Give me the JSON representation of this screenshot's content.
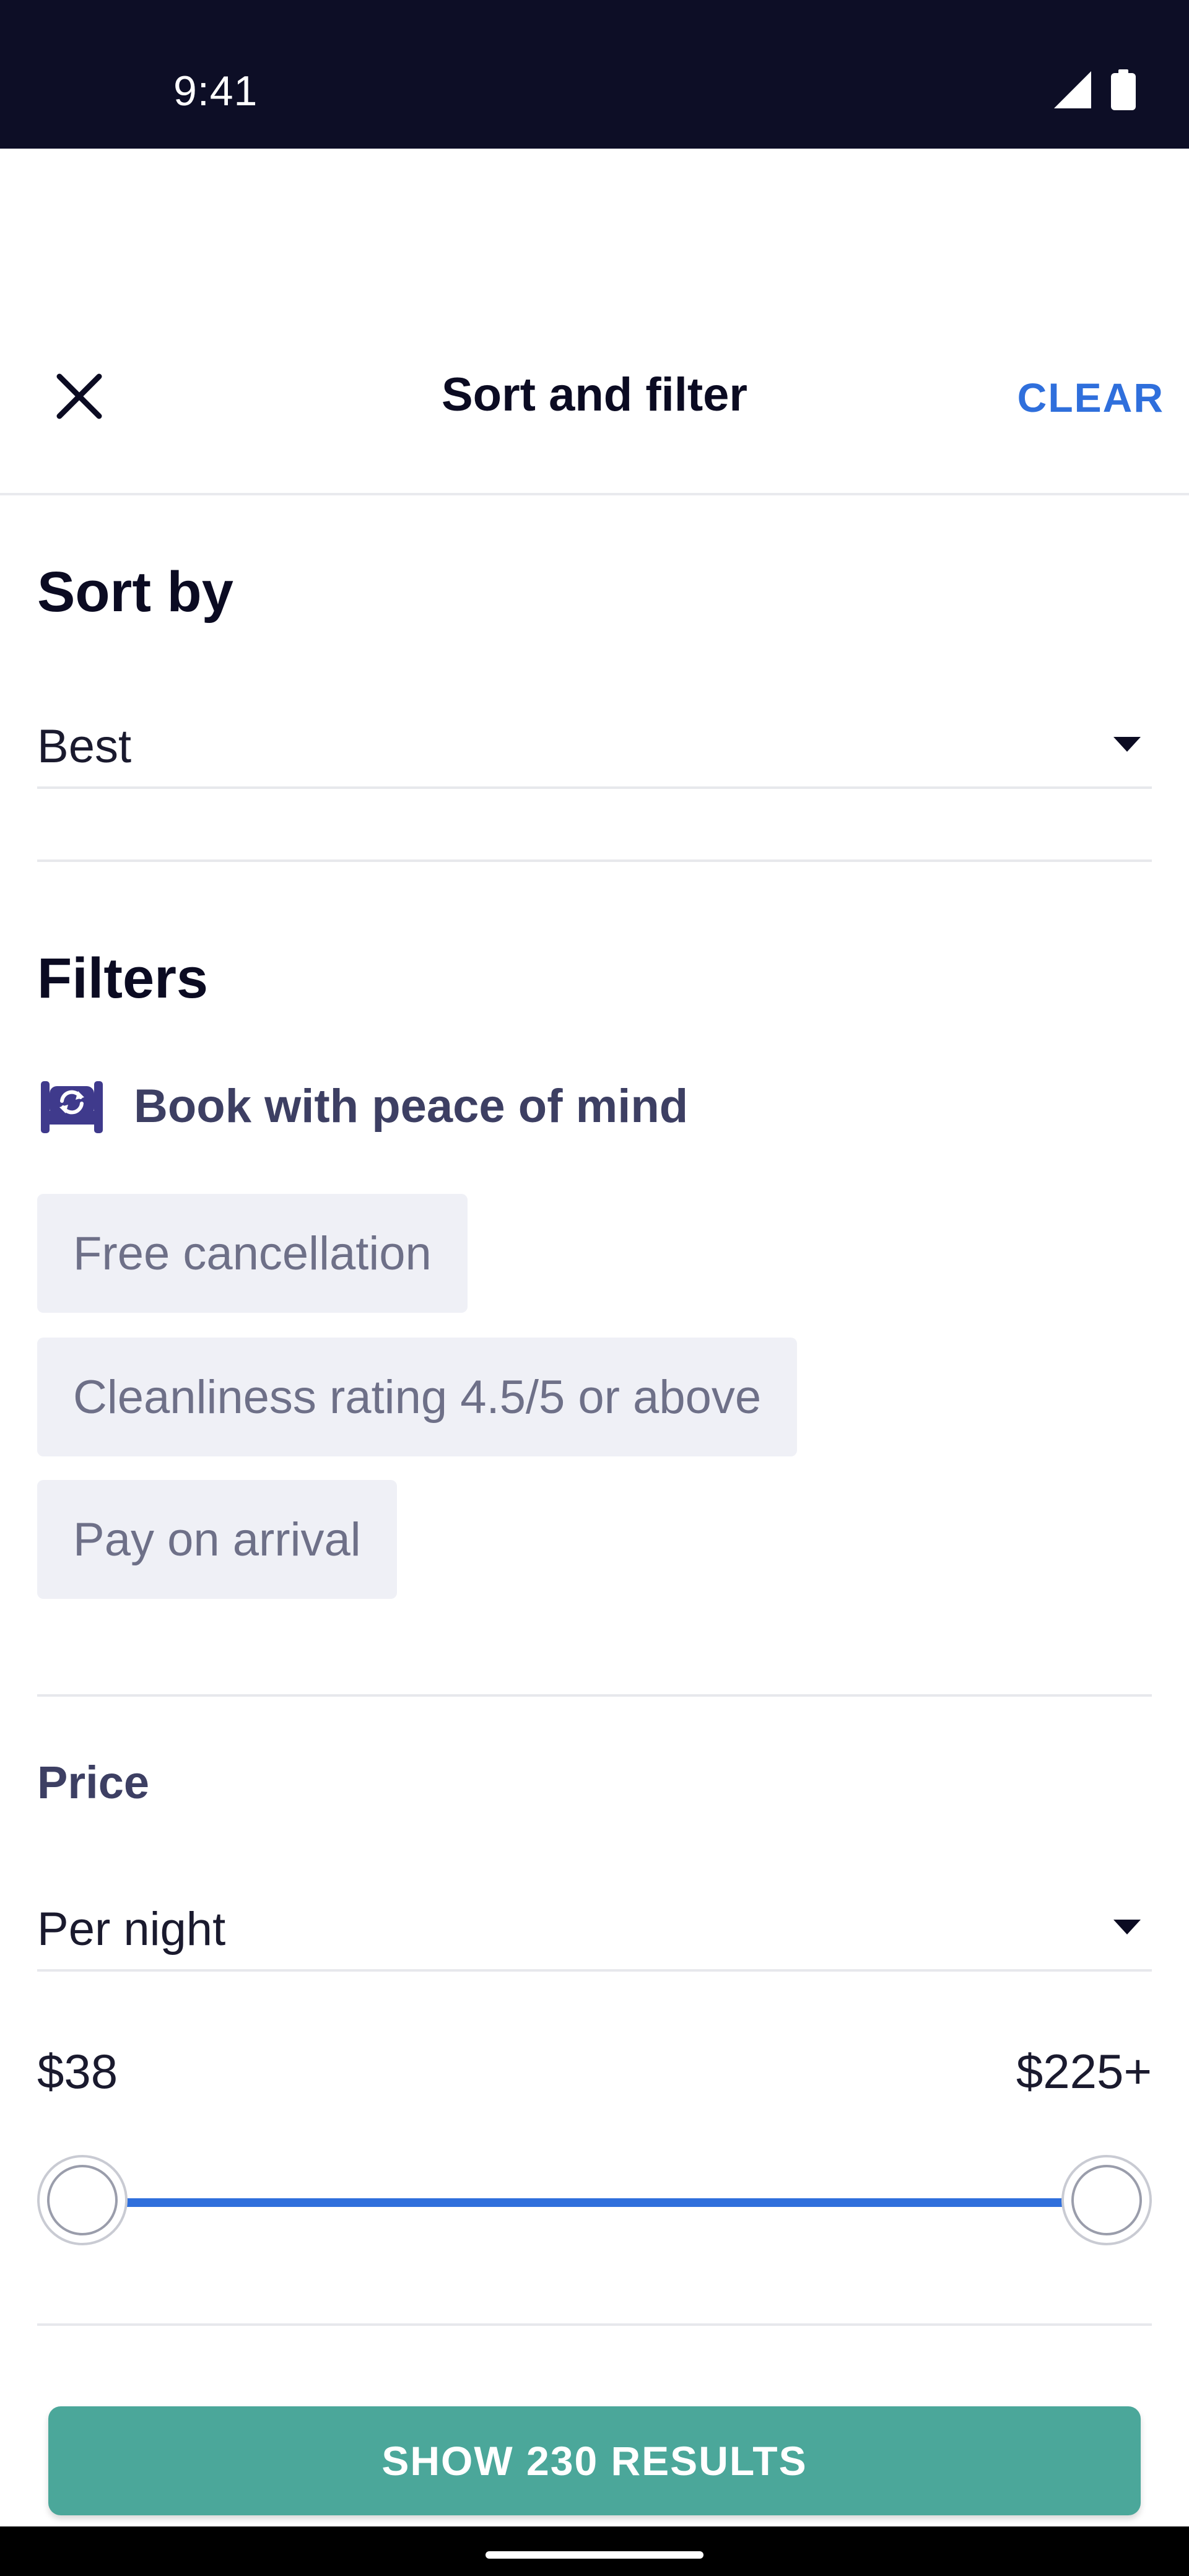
{
  "status_bar": {
    "time": "9:41"
  },
  "header": {
    "title": "Sort and filter",
    "clear_label": "CLEAR"
  },
  "sort": {
    "title": "Sort by",
    "selected": "Best"
  },
  "filters": {
    "title": "Filters",
    "peace_of_mind_label": "Book with peace of mind",
    "chips": [
      "Free cancellation",
      "Cleanliness rating 4.5/5 or above",
      "Pay on arrival"
    ]
  },
  "price": {
    "title": "Price",
    "mode": "Per night",
    "min_label": "$38",
    "max_label": "$225+",
    "accent_color": "#2f6fdc"
  },
  "cta": {
    "label": "SHOW 230 RESULTS",
    "color": "#4ba79a"
  }
}
